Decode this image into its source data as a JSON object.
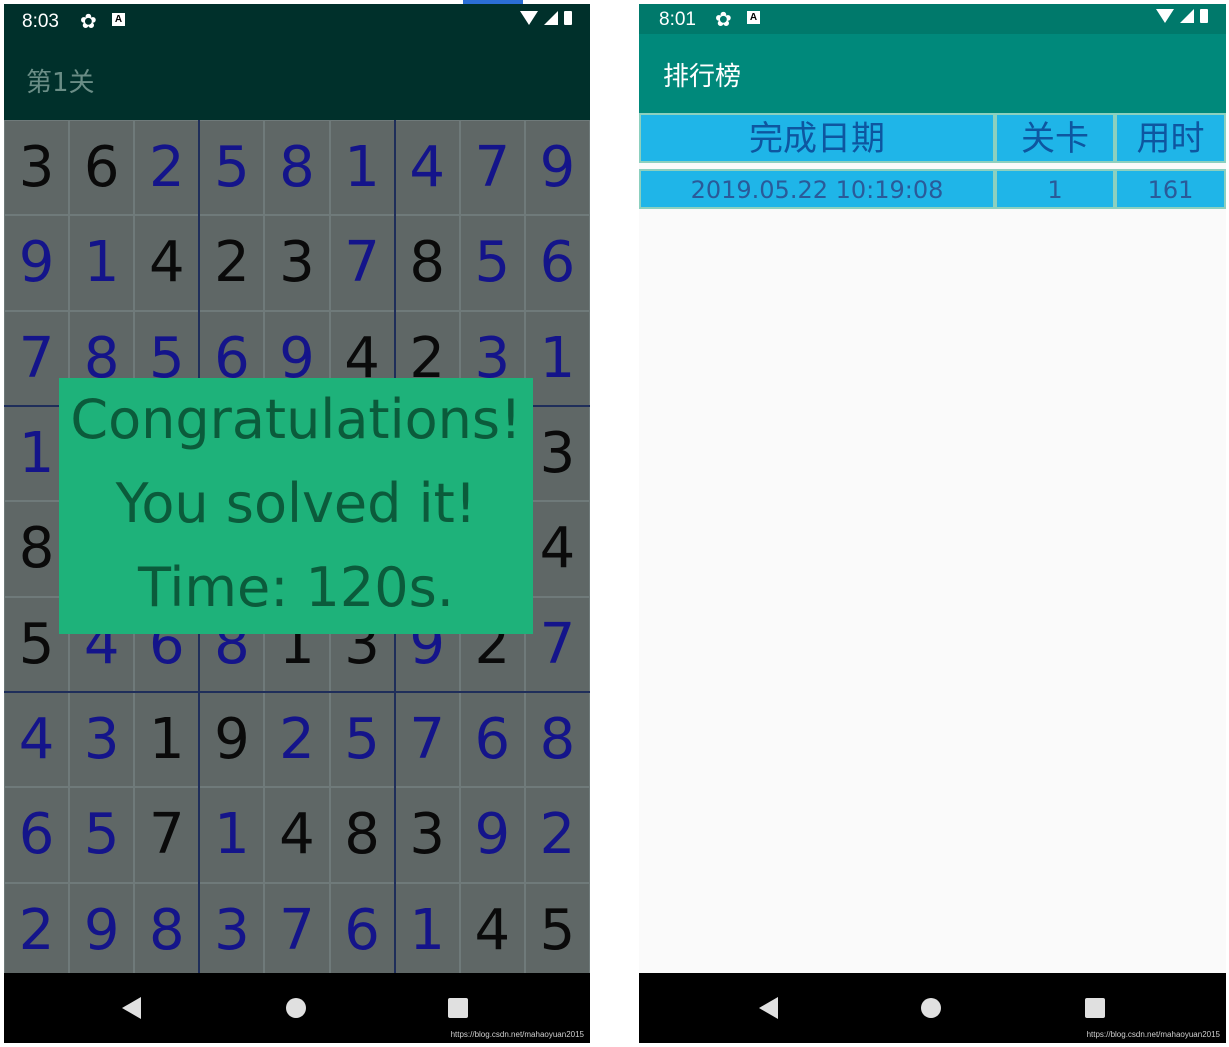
{
  "left_screen": {
    "status": {
      "time": "8:03"
    },
    "title": "第1关",
    "grid": {
      "rows": [
        [
          "3",
          "6",
          "2",
          "5",
          "8",
          "1",
          "4",
          "7",
          "9"
        ],
        [
          "9",
          "1",
          "4",
          "2",
          "3",
          "7",
          "8",
          "5",
          "6"
        ],
        [
          "7",
          "8",
          "5",
          "6",
          "9",
          "4",
          "2",
          "3",
          "1"
        ],
        [
          "1",
          "",
          "",
          "",
          "",
          "",
          "",
          "",
          "3"
        ],
        [
          "8",
          "",
          "",
          "",
          "",
          "",
          "",
          "",
          "4"
        ],
        [
          "5",
          "4",
          "6",
          "8",
          "1",
          "3",
          "9",
          "2",
          "7"
        ],
        [
          "4",
          "3",
          "1",
          "9",
          "2",
          "5",
          "7",
          "6",
          "8"
        ],
        [
          "6",
          "5",
          "7",
          "1",
          "4",
          "8",
          "3",
          "9",
          "2"
        ],
        [
          "2",
          "9",
          "8",
          "3",
          "7",
          "6",
          "1",
          "4",
          "5"
        ]
      ],
      "given_mask": [
        [
          1,
          1,
          0,
          0,
          0,
          0,
          0,
          0,
          0
        ],
        [
          0,
          0,
          1,
          1,
          1,
          0,
          1,
          0,
          0
        ],
        [
          0,
          0,
          0,
          0,
          0,
          1,
          1,
          0,
          0
        ],
        [
          0,
          0,
          0,
          0,
          0,
          0,
          0,
          0,
          1
        ],
        [
          1,
          0,
          0,
          0,
          0,
          0,
          0,
          0,
          1
        ],
        [
          1,
          0,
          0,
          0,
          1,
          1,
          0,
          1,
          0
        ],
        [
          0,
          0,
          1,
          1,
          0,
          0,
          0,
          0,
          0
        ],
        [
          0,
          0,
          1,
          0,
          1,
          1,
          1,
          0,
          0
        ],
        [
          0,
          0,
          0,
          0,
          0,
          0,
          0,
          1,
          1
        ]
      ]
    },
    "dialog": {
      "line1": "Congratulations!",
      "line2": "You solved it!",
      "line3": "Time:  120s."
    },
    "watermark": "https://blog.csdn.net/mahaoyuan2015"
  },
  "right_screen": {
    "status": {
      "time": "8:01"
    },
    "title": "排行榜",
    "table": {
      "headers": [
        "完成日期",
        "关卡",
        "用时"
      ],
      "rows": [
        [
          "2019.05.22 10:19:08",
          "1",
          "161"
        ]
      ]
    },
    "watermark": "https://blog.csdn.net/mahaoyuan2015"
  },
  "colors": {
    "toolbar_dark": "#00302b",
    "toolbar_teal": "#00897b",
    "dialog_bg": "#1eb27a",
    "table_bg": "#1fb5e8"
  }
}
